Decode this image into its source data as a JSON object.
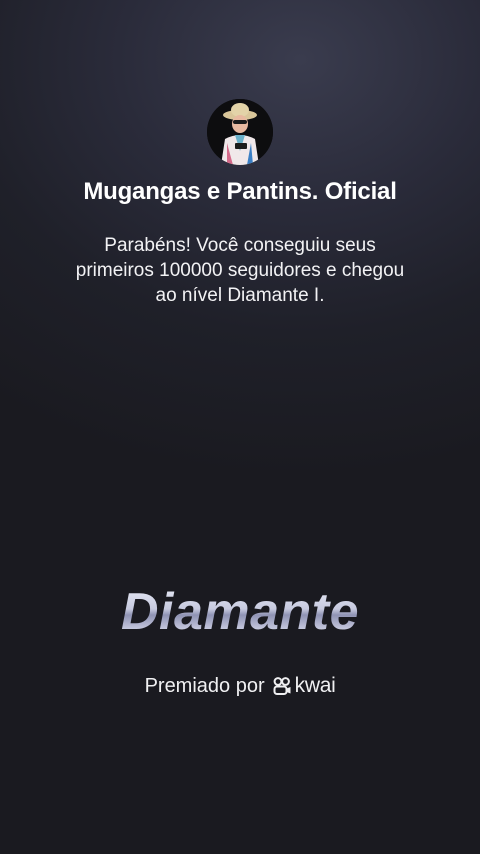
{
  "profile": {
    "name": "Mugangas e Pantins. Oficial",
    "avatar_icon": "avatar-photo"
  },
  "message": "Parabéns! Você conseguiu seus primeiros 100000 seguidores e chegou ao nível Diamante I.",
  "level": {
    "title": "Diamante"
  },
  "awarded_by": {
    "label": "Premiado por",
    "brand": "kwai",
    "brand_icon": "kwai-logo-icon"
  }
}
